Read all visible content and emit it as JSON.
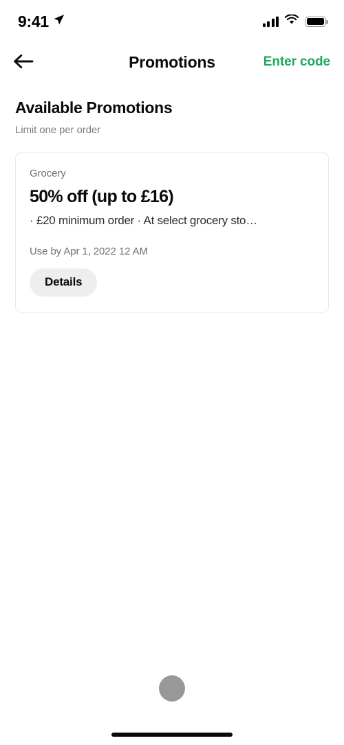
{
  "status_bar": {
    "time": "9:41",
    "location_icon": "location-arrow-icon",
    "cellular_icon": "cellular-bars-icon",
    "wifi_icon": "wifi-icon",
    "battery_icon": "battery-full-icon"
  },
  "nav": {
    "back_icon": "back-arrow-icon",
    "title": "Promotions",
    "action_label": "Enter code",
    "action_color": "#1FA85C"
  },
  "section": {
    "title": "Available Promotions",
    "subtitle": "Limit one per order"
  },
  "promotions": [
    {
      "category": "Grocery",
      "headline": "50% off (up to £16)",
      "description": "· £20 minimum order · At select grocery sto…",
      "expiry": "Use by Apr 1, 2022 12 AM",
      "button_label": "Details"
    }
  ],
  "footer": {
    "loading_indicator": "loading-dot",
    "home_indicator": "home-indicator"
  },
  "colors": {
    "accent_green": "#1FA85C",
    "text_primary": "#0A0A0A",
    "text_secondary": "#6F6F73",
    "card_border": "#E8E8EA",
    "button_bg": "#EEEEEF",
    "dot_gray": "#989898"
  }
}
